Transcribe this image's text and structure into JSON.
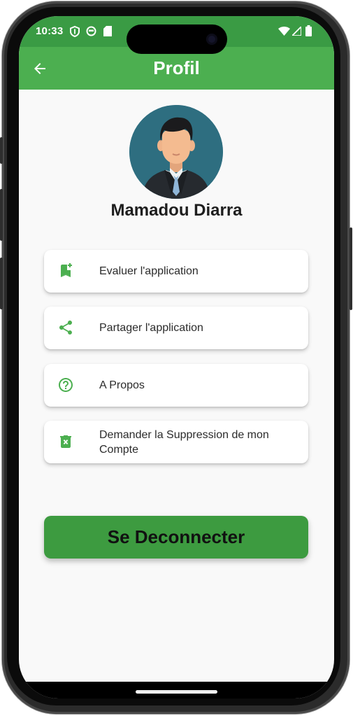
{
  "status_bar": {
    "time": "10:33",
    "left_icons": [
      "shield-icon",
      "circle-status-icon",
      "sd-card-icon"
    ],
    "right_icons": [
      "wifi-icon",
      "signal-icon",
      "battery-icon"
    ]
  },
  "app_bar": {
    "title": "Profil",
    "back_icon": "arrow-left-icon"
  },
  "profile": {
    "avatar": "user-avatar-illustration",
    "name": "Mamadou Diarra"
  },
  "menu": {
    "items": [
      {
        "label": "Evaluer l'application",
        "icon": "bookmark-add-icon"
      },
      {
        "label": "Partager l'application",
        "icon": "share-icon"
      },
      {
        "label": "A Propos",
        "icon": "help-circle-icon"
      },
      {
        "label": "Demander la Suppression de mon Compte",
        "icon": "delete-icon"
      }
    ]
  },
  "logout_button": {
    "label": "Se Deconnecter"
  },
  "colors": {
    "status_bar": "#3a9b44",
    "app_bar": "#4caf50",
    "icon_green": "#4caf50",
    "logout_button": "#3d9b40",
    "background": "#f9f9f9"
  }
}
